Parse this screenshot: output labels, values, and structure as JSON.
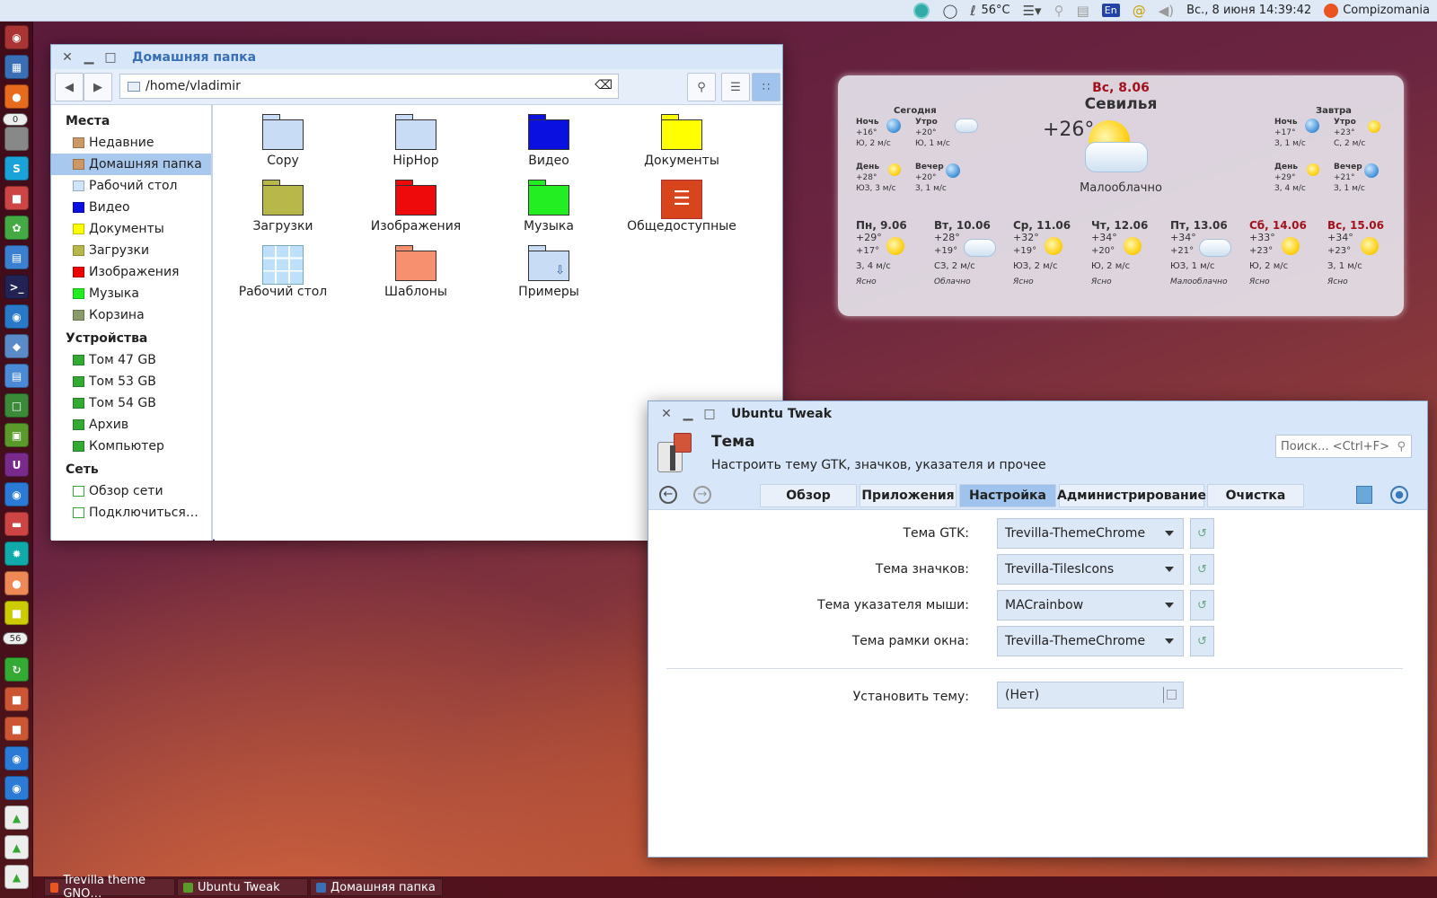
{
  "top_panel": {
    "temperature": "56°C",
    "lang": "En",
    "datetime": "Вс., 8 июня 14:39:42",
    "user": "Compizomania"
  },
  "launcher": {
    "badges": [
      "0",
      "56"
    ]
  },
  "file_manager": {
    "title": "Домашняя папка",
    "path": "/home/vladimir",
    "sidebar": {
      "places_header": "Места",
      "places": [
        "Недавние",
        "Домашняя папка",
        "Рабочий стол",
        "Видео",
        "Документы",
        "Загрузки",
        "Изображения",
        "Музыка",
        "Корзина"
      ],
      "devices_header": "Устройства",
      "devices": [
        "Том 47 GB",
        "Том 53 GB",
        "Том 54 GB",
        "Архив",
        "Компьютер"
      ],
      "network_header": "Сеть",
      "network": [
        "Обзор сети",
        "Подключиться…"
      ]
    },
    "files": [
      "Copy",
      "HipHop",
      "Видео",
      "Документы",
      "Загрузки",
      "Изображения",
      "Музыка",
      "Общедоступные",
      "Рабочий стол",
      "Шаблоны",
      "Примеры"
    ],
    "colors": {
      "folder_light": "#c9dcf5",
      "folder_blue": "#0a10e0",
      "folder_yellow": "#ffff00",
      "folder_olive": "#b8b84a",
      "folder_red": "#ee0a0a",
      "folder_green": "#22ee22",
      "folder_salmon": "#f7906e",
      "public_icon": "#d8441c"
    }
  },
  "weather": {
    "date": "Вс, 8.06",
    "city": "Севилья",
    "temp": "+26°",
    "condition": "Малооблачно",
    "today_label": "Сегодня",
    "tomorrow_label": "Завтра",
    "today": [
      {
        "label": "Ночь",
        "temp": "+16°",
        "wind": "Ю, 2 м/с"
      },
      {
        "label": "Утро",
        "temp": "+20°",
        "wind": "Ю, 1 м/с"
      },
      {
        "label": "День",
        "temp": "+28°",
        "wind": "ЮЗ, 3 м/с"
      },
      {
        "label": "Вечер",
        "temp": "+20°",
        "wind": "З, 1 м/с"
      }
    ],
    "tomorrow": [
      {
        "label": "Ночь",
        "temp": "+17°",
        "wind": "З, 1 м/с"
      },
      {
        "label": "Утро",
        "temp": "+23°",
        "wind": "С, 2 м/с"
      },
      {
        "label": "День",
        "temp": "+29°",
        "wind": "З, 4 м/с"
      },
      {
        "label": "Вечер",
        "temp": "+21°",
        "wind": "З, 1 м/с"
      }
    ],
    "forecast": [
      {
        "day": "Пн, 9.06",
        "hi": "+29°",
        "lo": "+17°",
        "wind": "З, 4 м/с",
        "desc": "Ясно"
      },
      {
        "day": "Вт, 10.06",
        "hi": "+28°",
        "lo": "+19°",
        "wind": "СЗ, 2 м/с",
        "desc": "Облачно"
      },
      {
        "day": "Ср, 11.06",
        "hi": "+32°",
        "lo": "+19°",
        "wind": "ЮЗ, 2 м/с",
        "desc": "Ясно"
      },
      {
        "day": "Чт, 12.06",
        "hi": "+34°",
        "lo": "+20°",
        "wind": "Ю, 2 м/с",
        "desc": "Ясно"
      },
      {
        "day": "Пт, 13.06",
        "hi": "+34°",
        "lo": "+21°",
        "wind": "ЮЗ, 1 м/с",
        "desc": "Малооблачно"
      },
      {
        "day": "Сб, 14.06",
        "hi": "+33°",
        "lo": "+23°",
        "wind": "Ю, 2 м/с",
        "desc": "Ясно"
      },
      {
        "day": "Вс, 15.06",
        "hi": "+34°",
        "lo": "+23°",
        "wind": "З, 1 м/с",
        "desc": "Ясно"
      }
    ]
  },
  "ubuntu_tweak": {
    "title": "Ubuntu Tweak",
    "section_title": "Тема",
    "section_desc": "Настроить тему GTK, значков, указателя и прочее",
    "search_placeholder": "Поиск... <Ctrl+F>",
    "tabs": [
      "Обзор",
      "Приложения",
      "Настройка",
      "Администрирование",
      "Очистка"
    ],
    "active_tab": "Настройка",
    "fields": [
      {
        "label": "Тема GTK:",
        "value": "Trevilla-ThemeChrome"
      },
      {
        "label": "Тема значков:",
        "value": "Trevilla-TilesIcons"
      },
      {
        "label": "Тема указателя мыши:",
        "value": "MACrainbow"
      },
      {
        "label": "Тема рамки окна:",
        "value": "Trevilla-ThemeChrome"
      }
    ],
    "install": {
      "label": "Установить тему:",
      "value": "(Нет)"
    }
  },
  "taskbar": [
    "Trevilla theme GNO…",
    "Ubuntu Tweak",
    "Домашняя папка"
  ]
}
